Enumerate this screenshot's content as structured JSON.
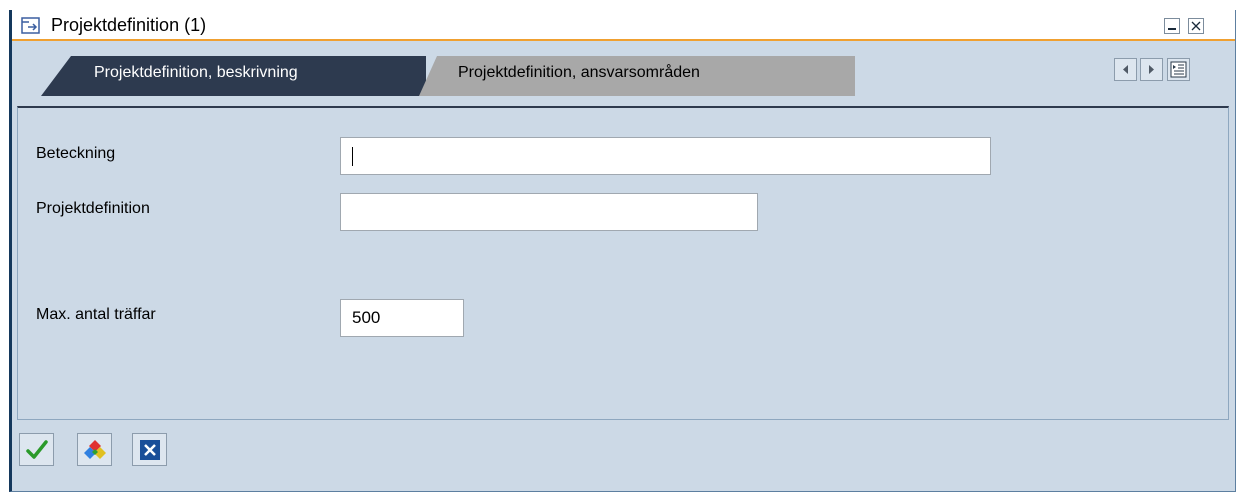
{
  "window": {
    "title": "Projektdefinition (1)"
  },
  "tabs": [
    {
      "label": "Projektdefinition, beskrivning",
      "active": true
    },
    {
      "label": "Projektdefinition, ansvarsområden",
      "active": false
    }
  ],
  "form": {
    "fields": [
      {
        "label": "Beteckning",
        "value": ""
      },
      {
        "label": "Projektdefinition",
        "value": ""
      },
      {
        "label": "Max. antal träffar",
        "value": "500"
      }
    ]
  },
  "toolbar": {
    "icons": [
      "checkmark-icon",
      "multiple-selection-icon",
      "close-icon"
    ]
  },
  "colors": {
    "active_tab": "#2d3a4f",
    "inactive_tab": "#a8a8a8",
    "panel_bg": "#ccd9e6",
    "title_underline": "#f0a030",
    "confirm_green": "#2a9a2a",
    "cancel_blue": "#1a4f99"
  }
}
